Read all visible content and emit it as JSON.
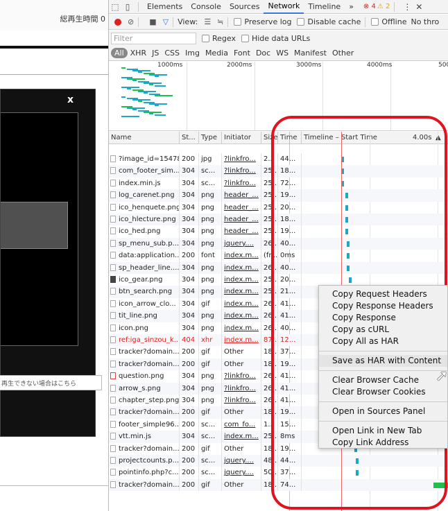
{
  "page": {
    "header_text": "総再生時間 0",
    "notice_text": "再生できない場合はこちら",
    "close_label": "x"
  },
  "devtools": {
    "tabs": [
      "Elements",
      "Console",
      "Sources",
      "Network",
      "Timeline"
    ],
    "more_tabs": "»",
    "error_count": "4",
    "warning_count": "2",
    "toolbar": {
      "view_label": "View:",
      "preserve_log": "Preserve log",
      "disable_cache": "Disable cache",
      "offline": "Offline",
      "throttle": "No thro"
    },
    "filter": {
      "placeholder": "Filter",
      "regex": "Regex",
      "hide_data_urls": "Hide data URLs"
    },
    "types": [
      "All",
      "XHR",
      "JS",
      "CSS",
      "Img",
      "Media",
      "Font",
      "Doc",
      "WS",
      "Manifest",
      "Other"
    ],
    "overview_ticks": [
      "1000ms",
      "2000ms",
      "3000ms",
      "4000ms",
      "500"
    ],
    "columns": {
      "name": "Name",
      "status": "St...",
      "type": "Type",
      "initiator": "Initiator",
      "size": "Size",
      "time": "Time",
      "timeline": "Timeline – Start Time",
      "timeline_scale": "4.00s",
      "sort_icon": "▲"
    },
    "rows": [
      {
        "name": "?image_id=15478",
        "status": "200",
        "type": "jpg",
        "initiator": "?linkfro...",
        "size": "2...",
        "time": "44...",
        "icon": "file",
        "tl": 0.27
      },
      {
        "name": "com_footer_sim...",
        "status": "304",
        "type": "sc...",
        "initiator": "?linkfro...",
        "size": "25...",
        "time": "18...",
        "icon": "file",
        "tl": 0.27
      },
      {
        "name": "index.min.js",
        "status": "304",
        "type": "sc...",
        "initiator": "?linkfro...",
        "size": "25...",
        "time": "72...",
        "icon": "file",
        "tl": 0.27
      },
      {
        "name": "log_carenet.png",
        "status": "304",
        "type": "png",
        "initiator": "header_...",
        "size": "25...",
        "time": "19...",
        "icon": "img",
        "tl": 0.3
      },
      {
        "name": "ico_henquete.png",
        "status": "304",
        "type": "png",
        "initiator": "header_...",
        "size": "25...",
        "time": "20...",
        "icon": "img",
        "tl": 0.3
      },
      {
        "name": "ico_hlecture.png",
        "status": "304",
        "type": "png",
        "initiator": "header_...",
        "size": "25...",
        "time": "18...",
        "icon": "img",
        "tl": 0.3
      },
      {
        "name": "ico_hed.png",
        "status": "304",
        "type": "png",
        "initiator": "header_...",
        "size": "25...",
        "time": "19...",
        "icon": "img",
        "tl": 0.3
      },
      {
        "name": "sp_menu_sub.p...",
        "status": "304",
        "type": "png",
        "initiator": "jquery....",
        "size": "26...",
        "time": "40...",
        "icon": "img",
        "tl": 0.31
      },
      {
        "name": "data:application...",
        "status": "200",
        "type": "font",
        "initiator": "index.m...",
        "size": "(fr...",
        "time": "0ms",
        "icon": "file",
        "tl": 0.31
      },
      {
        "name": "sp_header_line....",
        "status": "304",
        "type": "png",
        "initiator": "index.m...",
        "size": "26...",
        "time": "40...",
        "icon": "img",
        "tl": 0.31
      },
      {
        "name": "ico_gear.png",
        "status": "304",
        "type": "png",
        "initiator": "index.m...",
        "size": "25...",
        "time": "20...",
        "icon": "gear",
        "tl": 0.32
      },
      {
        "name": "btn_search.png",
        "status": "304",
        "type": "png",
        "initiator": "index.m...",
        "size": "25...",
        "time": "21...",
        "icon": "img",
        "tl": 0.32
      },
      {
        "name": "icon_arrow_clo...",
        "status": "304",
        "type": "gif",
        "initiator": "index.m...",
        "size": "26...",
        "time": "41...",
        "icon": "img",
        "tl": 0.32
      },
      {
        "name": "tit_line.png",
        "status": "304",
        "type": "png",
        "initiator": "index.m...",
        "size": "26...",
        "time": "41...",
        "icon": "img",
        "tl": 0.32
      },
      {
        "name": "icon.png",
        "status": "304",
        "type": "png",
        "initiator": "index.m...",
        "size": "26...",
        "time": "40...",
        "icon": "file",
        "tl": 0.32
      },
      {
        "name": "ref:iga_sinzou_k...",
        "status": "404",
        "type": "xhr",
        "initiator": "index.m...",
        "size": "87...",
        "time": "12...",
        "icon": "file",
        "tl": 0.33,
        "error": true
      },
      {
        "name": "tracker?domain...",
        "status": "200",
        "type": "gif",
        "initiator": "Other",
        "size": "18...",
        "time": "37...",
        "icon": "file",
        "tl": 0.33
      },
      {
        "name": "tracker?domain...",
        "status": "200",
        "type": "gif",
        "initiator": "Other",
        "size": "18...",
        "time": "19...",
        "icon": "file",
        "tl": 0.33
      },
      {
        "name": "question.png",
        "status": "304",
        "type": "png",
        "initiator": "?linkfro...",
        "size": "26...",
        "time": "41...",
        "icon": "q",
        "tl": 0.34
      },
      {
        "name": "arrow_s.png",
        "status": "304",
        "type": "png",
        "initiator": "?linkfro...",
        "size": "26...",
        "time": "41...",
        "icon": "file",
        "tl": 0.34
      },
      {
        "name": "chapter_step.png",
        "status": "304",
        "type": "png",
        "initiator": "?linkfro...",
        "size": "26...",
        "time": "41...",
        "icon": "img",
        "tl": 0.34
      },
      {
        "name": "tracker?domain...",
        "status": "200",
        "type": "gif",
        "initiator": "Other",
        "size": "18...",
        "time": "19...",
        "icon": "file",
        "tl": 0.35
      },
      {
        "name": "footer_simple96...",
        "status": "200",
        "type": "sc...",
        "initiator": "com_fo...",
        "size": "1...",
        "time": "15...",
        "icon": "file",
        "tl": 0.35
      },
      {
        "name": "vtt.min.js",
        "status": "304",
        "type": "sc...",
        "initiator": "index.m...",
        "size": "25...",
        "time": "8ms",
        "icon": "file",
        "tl": 0.36
      },
      {
        "name": "tracker?domain...",
        "status": "200",
        "type": "gif",
        "initiator": "Other",
        "size": "18...",
        "time": "19...",
        "icon": "file",
        "tl": 0.36
      },
      {
        "name": "projectcounts.p...",
        "status": "200",
        "type": "sc...",
        "initiator": "jquery....",
        "size": "48...",
        "time": "44...",
        "icon": "file",
        "tl": 0.37
      },
      {
        "name": "pointinfo.php?c...",
        "status": "200",
        "type": "sc...",
        "initiator": "jquery....",
        "size": "50...",
        "time": "37...",
        "icon": "file",
        "tl": 0.37
      },
      {
        "name": "tracker?domain...",
        "status": "200",
        "type": "gif",
        "initiator": "Other",
        "size": "18...",
        "time": "74...",
        "icon": "file",
        "tl": 0.9
      }
    ],
    "context_menu": [
      [
        "Copy Request Headers",
        "Copy Response Headers",
        "Copy Response",
        "Copy as cURL",
        "Copy All as HAR"
      ],
      [
        "Save as HAR with Content"
      ],
      [
        "Clear Browser Cache",
        "Clear Browser Cookies"
      ],
      [
        "Open in Sources Panel"
      ],
      [
        "Open Link in New Tab",
        "Copy Link Address"
      ]
    ],
    "hovered_item": "Save as HAR with Content",
    "colors": {
      "annotation_ring": "#e0141e",
      "record": "#e0201c",
      "accent": "#3879d9",
      "timing_bar": "#1ea7c4"
    }
  }
}
